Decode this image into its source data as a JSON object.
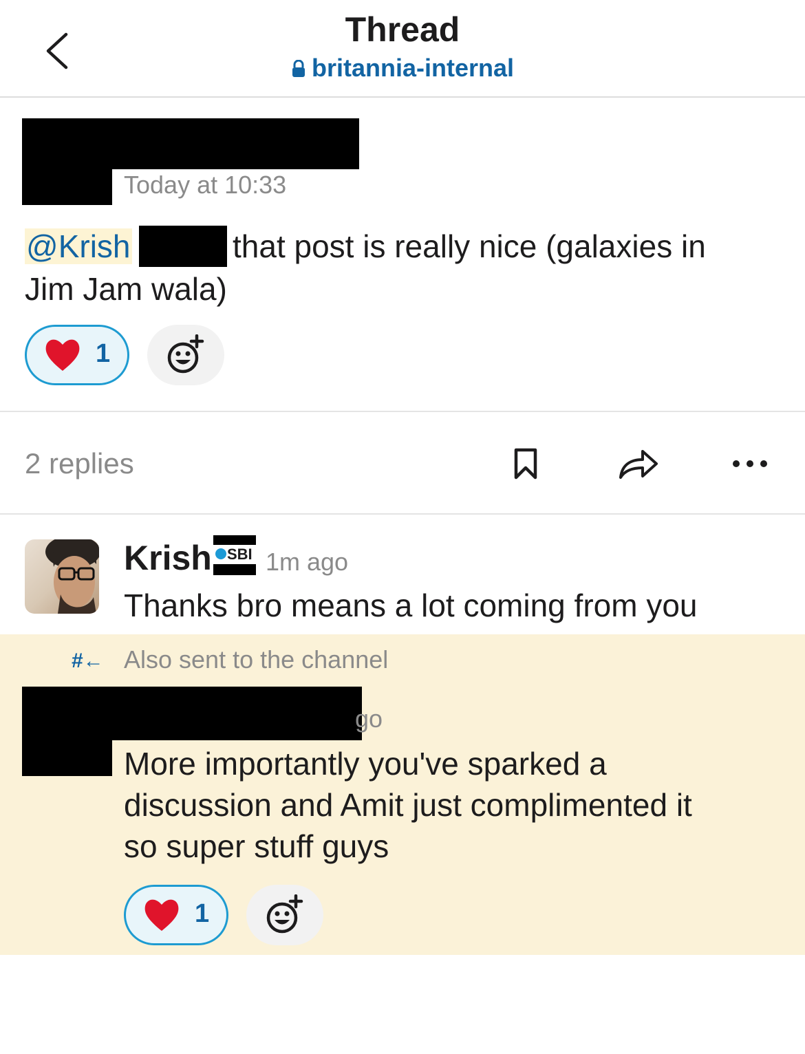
{
  "header": {
    "title": "Thread",
    "channel": "britannia-internal"
  },
  "parent_message": {
    "timestamp": "Today at 10:33",
    "mention": "@Krish",
    "text_after_mention": "that post is really nice (galaxies in",
    "text_line2": "Jim Jam wala)",
    "reaction": {
      "emoji": "heart-emoji",
      "count": "1"
    }
  },
  "thread_bar": {
    "replies": "2 replies",
    "actions": [
      "bookmark-icon",
      "share-icon",
      "more-icon"
    ]
  },
  "replies": [
    {
      "sender": "Krish",
      "badge": "SBI",
      "time": "1m ago",
      "text": "Thanks bro means a lot coming from you"
    },
    {
      "also_sent": "Also sent to the channel",
      "time_partial": "go",
      "lines": [
        "More importantly you've sparked a",
        "discussion and Amit just complimented it",
        "so super stuff guys"
      ],
      "reaction": {
        "emoji": "heart-emoji",
        "count": "1"
      }
    }
  ],
  "colors": {
    "link": "#1264a3",
    "highlight": "#fbf2d8",
    "reaction_border": "#1d9bd1"
  }
}
